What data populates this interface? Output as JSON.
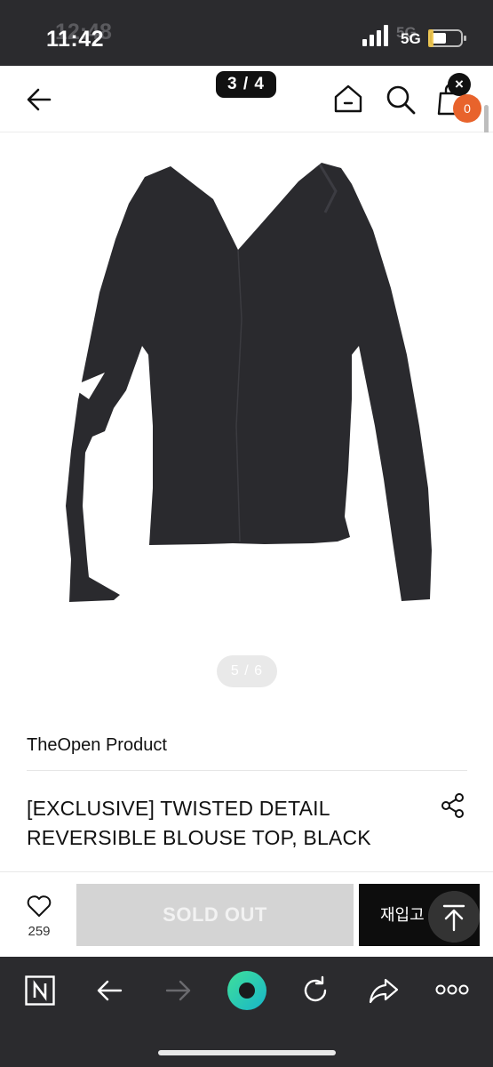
{
  "status_bar": {
    "time": "11:42",
    "time_ghost": "12:48",
    "network": "5G",
    "network_ghost": "5G"
  },
  "header": {
    "page_indicator": "3 / 4",
    "close_label": "×",
    "cart_count": "0"
  },
  "product": {
    "image_counter": "5 / 6",
    "brand": "TheOpen Product",
    "title_line1": "[EXCLUSIVE] TWISTED DETAIL",
    "title_line2": "REVERSIBLE BLOUSE TOP, BLACK"
  },
  "purchase_bar": {
    "likes": "259",
    "sold_out_label": "SOLD OUT",
    "restock_label": "재입고 알림"
  },
  "colors": {
    "accent_badge": "#e8632c",
    "status_bar_bg": "#2b2b2e",
    "garment": "#2a2a2e"
  },
  "icons": [
    "back-arrow-icon",
    "home-icon",
    "search-icon",
    "shopping-bag-icon",
    "close-icon",
    "share-icon",
    "heart-icon",
    "scroll-top-icon",
    "naver-icon",
    "browser-back-icon",
    "browser-forward-icon",
    "browser-home-icon",
    "reload-icon",
    "browser-share-icon",
    "more-icon"
  ]
}
